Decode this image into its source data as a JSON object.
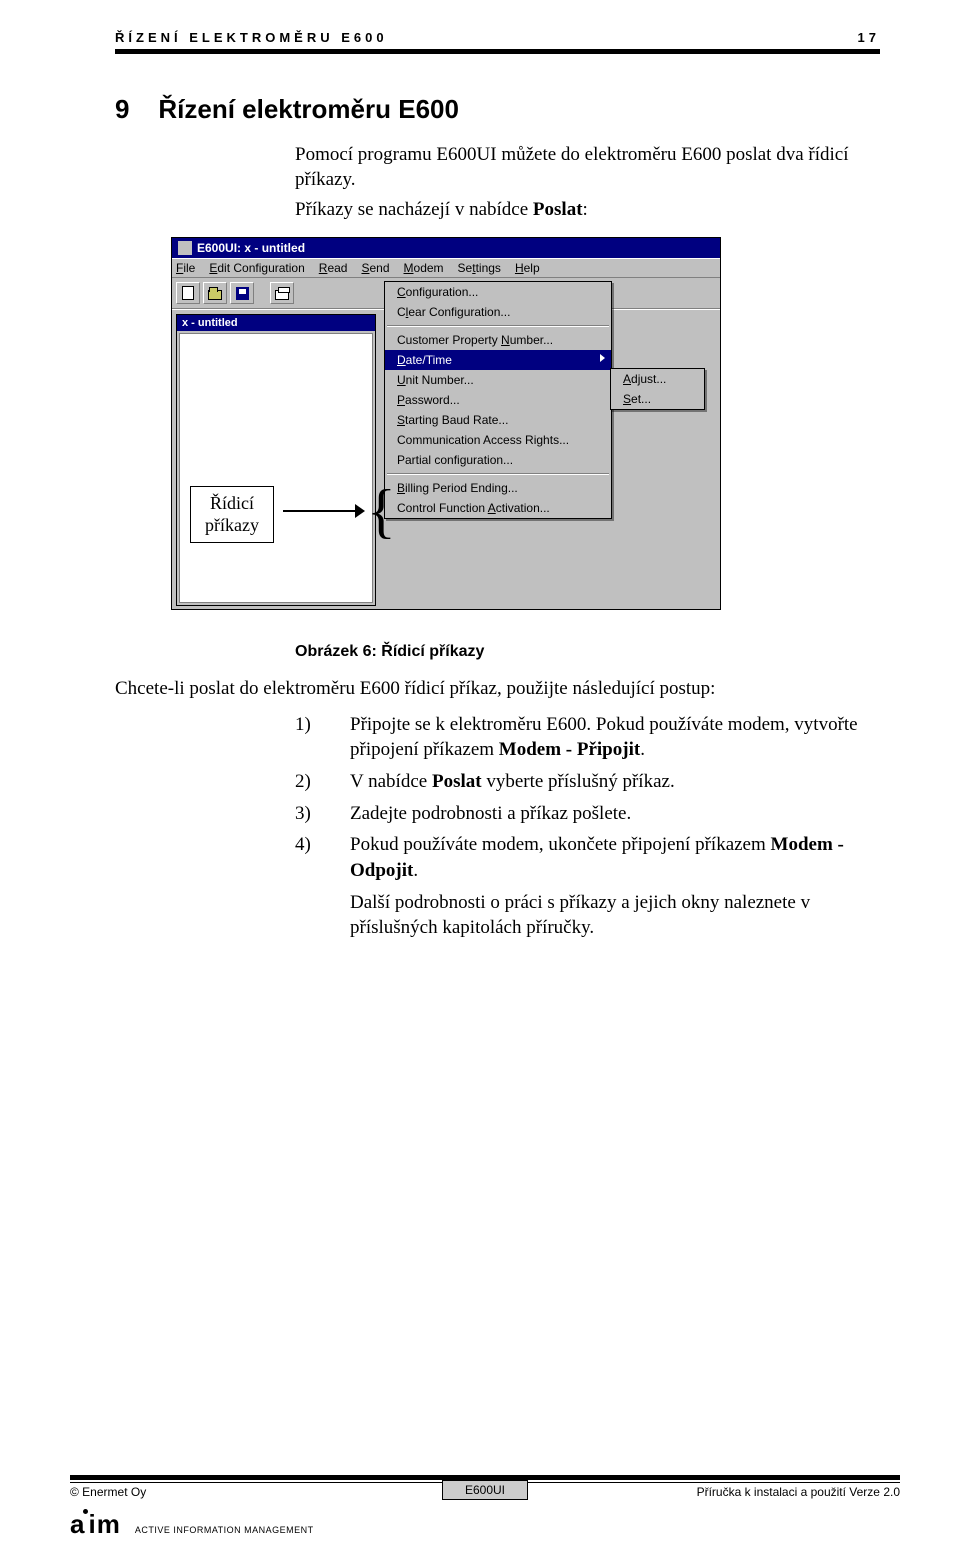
{
  "header": {
    "running_title": "ŘÍZENÍ ELEKTROMĚRU E600",
    "page_number": "17"
  },
  "section": {
    "number": "9",
    "title": "Řízení elektroměru E600"
  },
  "intro": "Pomocí programu E600UI můžete do elektroměru E600 poslat dva řídicí příkazy.",
  "lead_sentence": "Příkazy se nacházejí v nabídce Poslat:",
  "callout_label_line1": "Řídicí",
  "callout_label_line2": "příkazy",
  "caption": "Obrázek 6: Řídicí příkazy",
  "body_after_caption": "Chcete-li poslat do elektroměru E600 řídicí příkaz, použijte následující postup:",
  "steps": [
    {
      "num": "1)",
      "text_a": "Připojte se k elektroměru E600. Pokud používáte modem, vytvořte připojení příkazem ",
      "text_b": "Modem - Připojit",
      "text_c": "."
    },
    {
      "num": "2)",
      "text_a": "V nabídce ",
      "text_b": "Poslat",
      "text_c": " vyberte příslušný příkaz."
    },
    {
      "num": "3)",
      "text_a": "Zadejte podrobnosti a příkaz pošlete.",
      "text_b": "",
      "text_c": ""
    },
    {
      "num": "4)",
      "text_a": "Pokud používáte modem, ukončete připojení příkazem ",
      "text_b": "Modem - Odpojit",
      "text_c": "."
    }
  ],
  "closing": "Další podrobnosti o práci s příkazy a jejich okny naleznete v příslušných kapitolách příručky.",
  "screenshot": {
    "title": "E600UI: x - untitled",
    "menubar": [
      "File",
      "Edit Configuration",
      "Read",
      "Send",
      "Modem",
      "Settings",
      "Help"
    ],
    "inner_title": "x - untitled",
    "send_menu": [
      {
        "label": "Configuration..."
      },
      {
        "label": "Clear Configuration..."
      },
      {
        "sep": true
      },
      {
        "label": "Customer Property Number..."
      },
      {
        "label": "Date/Time",
        "selected": true,
        "submenu": true
      },
      {
        "label": "Unit Number..."
      },
      {
        "label": "Password..."
      },
      {
        "label": "Starting Baud Rate..."
      },
      {
        "label": "Communication Access Rights..."
      },
      {
        "label": "Partial configuration..."
      },
      {
        "sep": true
      },
      {
        "label": "Billing Period Ending..."
      },
      {
        "label": "Control Function Activation..."
      }
    ],
    "submenu": [
      {
        "label": "Adjust..."
      },
      {
        "label": "Set..."
      }
    ]
  },
  "footer": {
    "left": "© Enermet Oy",
    "center": "E600UI",
    "right": "Příručka k instalaci a použití Verze 2.0",
    "logo": "aim",
    "logo_sub": "ACTIVE INFORMATION MANAGEMENT"
  }
}
